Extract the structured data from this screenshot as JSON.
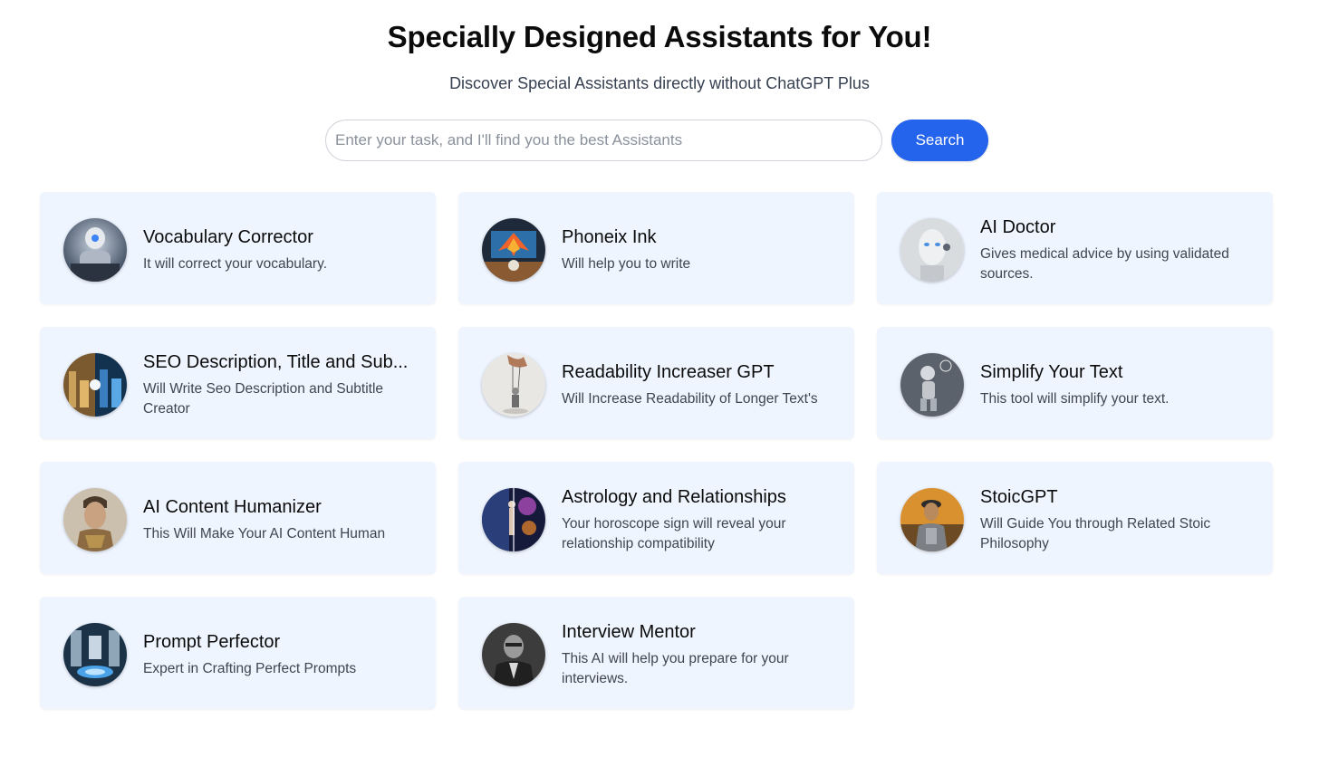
{
  "header": {
    "title": "Specially Designed Assistants for You!",
    "subtitle": "Discover Special Assistants directly without ChatGPT Plus"
  },
  "search": {
    "placeholder": "Enter your task, and I'll find you the best Assistants",
    "value": "",
    "button_label": "Search"
  },
  "colors": {
    "card_background": "#eff5ff",
    "accent": "#2463eb"
  },
  "assistants": [
    {
      "title": "Vocabulary Corrector",
      "description": "It will correct your vocabulary.",
      "avatar": "robot-writing-icon"
    },
    {
      "title": "Phoneix Ink",
      "description": "Will help you to write",
      "avatar": "phoenix-desk-icon"
    },
    {
      "title": "AI Doctor",
      "description": "Gives medical advice by using validated sources.",
      "avatar": "android-face-icon"
    },
    {
      "title": "SEO Description, Title and Sub...",
      "description": "Will Write Seo Description and Subtitle Creator",
      "avatar": "split-city-icon"
    },
    {
      "title": "Readability Increaser GPT",
      "description": "Will Increase Readability of Longer Text's",
      "avatar": "puppet-hand-icon"
    },
    {
      "title": "Simplify Your Text",
      "description": "This tool will simplify your text.",
      "avatar": "robot-thinking-icon"
    },
    {
      "title": "AI Content Humanizer",
      "description": "This Will Make Your AI Content Human",
      "avatar": "cyborg-man-icon"
    },
    {
      "title": "Astrology and Relationships",
      "description": "Your horoscope sign will reveal your relationship compatibility",
      "avatar": "cosmic-figure-icon"
    },
    {
      "title": "StoicGPT",
      "description": "Will Guide You through Related Stoic Philosophy",
      "avatar": "stoic-warrior-icon"
    },
    {
      "title": "Prompt Perfector",
      "description": "Expert in Crafting Perfect Prompts",
      "avatar": "futuristic-lab-icon"
    },
    {
      "title": "Interview Mentor",
      "description": "This AI will help you prepare for your interviews.",
      "avatar": "mentor-portrait-icon"
    }
  ]
}
